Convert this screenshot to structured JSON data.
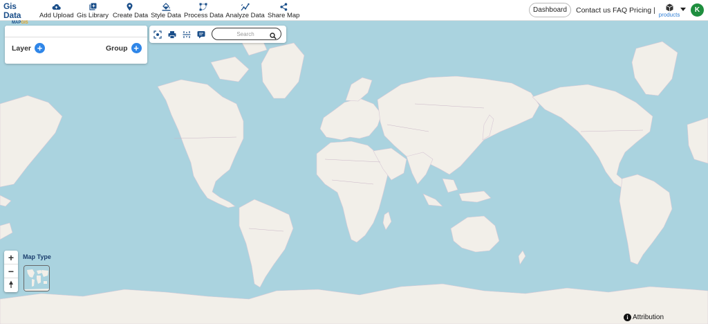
{
  "brand": {
    "line1": "Gis Data",
    "line2_a": "MAP",
    "line2_b": "GIS"
  },
  "nav": [
    {
      "label": "Add Upload",
      "icon": "cloud-upload-icon"
    },
    {
      "label": "Gis Library",
      "icon": "library-icon"
    },
    {
      "label": "Create Data",
      "icon": "map-pin-icon"
    },
    {
      "label": "Style Data",
      "icon": "paint-bucket-icon"
    },
    {
      "label": "Process Data",
      "icon": "process-icon"
    },
    {
      "label": "Analyze Data",
      "icon": "analyze-icon"
    },
    {
      "label": "Share Map",
      "icon": "share-icon"
    }
  ],
  "header_right": {
    "dashboard": "Dashboard",
    "contact": "Contact us",
    "faq": "FAQ",
    "pricing": "Pricing |",
    "products": "products",
    "avatar_initial": "K"
  },
  "layer_panel": {
    "layer_label": "Layer",
    "group_label": "Group"
  },
  "toolbar": {
    "search_placeholder": "Search"
  },
  "zoom": {
    "in": "+",
    "out": "−"
  },
  "map_type": {
    "label": "Map Type"
  },
  "attribution": {
    "label": "Attribution",
    "icon_glyph": "i"
  },
  "colors": {
    "ocean": "#aad3df",
    "land": "#f2efe9",
    "accent": "#2f86e8",
    "avatar": "#1e8e3e",
    "brand": "#1b4f8a"
  }
}
